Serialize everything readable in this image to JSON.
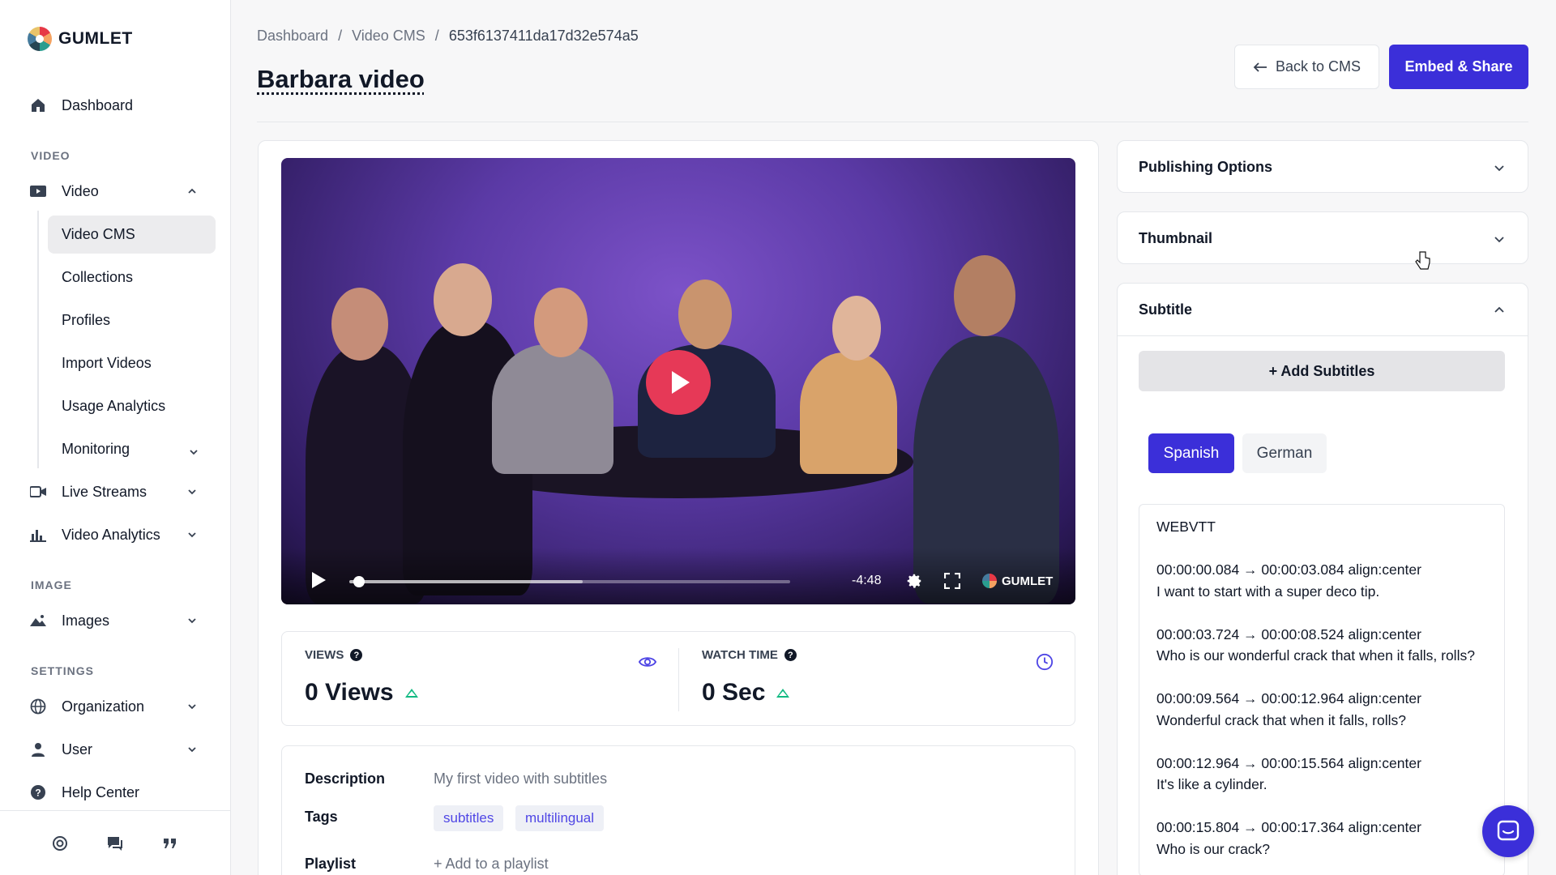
{
  "brand": {
    "name": "GUMLET"
  },
  "sidebar": {
    "dashboard": "Dashboard",
    "section_video": "VIDEO",
    "video": "Video",
    "video_sub": [
      "Video CMS",
      "Collections",
      "Profiles",
      "Import Videos",
      "Usage Analytics",
      "Monitoring"
    ],
    "live_streams": "Live Streams",
    "video_analytics": "Video Analytics",
    "section_image": "IMAGE",
    "images": "Images",
    "section_settings": "SETTINGS",
    "organization": "Organization",
    "user": "User",
    "help_center": "Help Center"
  },
  "breadcrumb": [
    "Dashboard",
    "Video CMS",
    "653f6137411da17d32e574a5"
  ],
  "page": {
    "title": "Barbara video"
  },
  "actions": {
    "back": "Back to CMS",
    "embed": "Embed & Share"
  },
  "player": {
    "time_remaining": "-4:48",
    "brand": "GUMLET",
    "progress": 0.01,
    "buffered": 0.53
  },
  "stats": {
    "views_label": "VIEWS",
    "views_value": "0 Views",
    "watch_label": "WATCH TIME",
    "watch_value": "0 Sec"
  },
  "details": {
    "description_label": "Description",
    "description_value": "My first video with subtitles",
    "tags_label": "Tags",
    "tags": [
      "subtitles",
      "multilingual"
    ],
    "playlist_label": "Playlist",
    "playlist_action": "+ Add to a playlist"
  },
  "panels": {
    "publishing": "Publishing Options",
    "thumbnail": "Thumbnail",
    "subtitle": "Subtitle",
    "add_subtitles": "+ Add Subtitles",
    "languages": [
      "Spanish",
      "German"
    ],
    "active_language": "Spanish",
    "vtt_header": "WEBVTT",
    "cues": [
      {
        "time": "00:00:00.084 → 00:00:03.084 align:center",
        "text": "I want to start with a super deco tip."
      },
      {
        "time": "00:00:03.724 → 00:00:08.524 align:center",
        "text": "Who is our wonderful crack that when it falls, rolls?"
      },
      {
        "time": "00:00:09.564 → 00:00:12.964 align:center",
        "text": "Wonderful crack that when it falls, rolls?"
      },
      {
        "time": "00:00:12.964 → 00:00:15.564 align:center",
        "text": "It's like a cylinder."
      },
      {
        "time": "00:00:15.804 → 00:00:17.364 align:center",
        "text": "Who is our crack?"
      }
    ]
  },
  "colors": {
    "accent": "#3b2fd9",
    "play": "#e63957",
    "trend": "#10b981"
  },
  "icons": [
    "home-icon",
    "video-icon",
    "live-icon",
    "analytics-icon",
    "images-icon",
    "globe-icon",
    "user-icon",
    "help-icon",
    "eye-icon",
    "clock-icon",
    "gear-icon",
    "fullscreen-icon",
    "chat-icon"
  ]
}
